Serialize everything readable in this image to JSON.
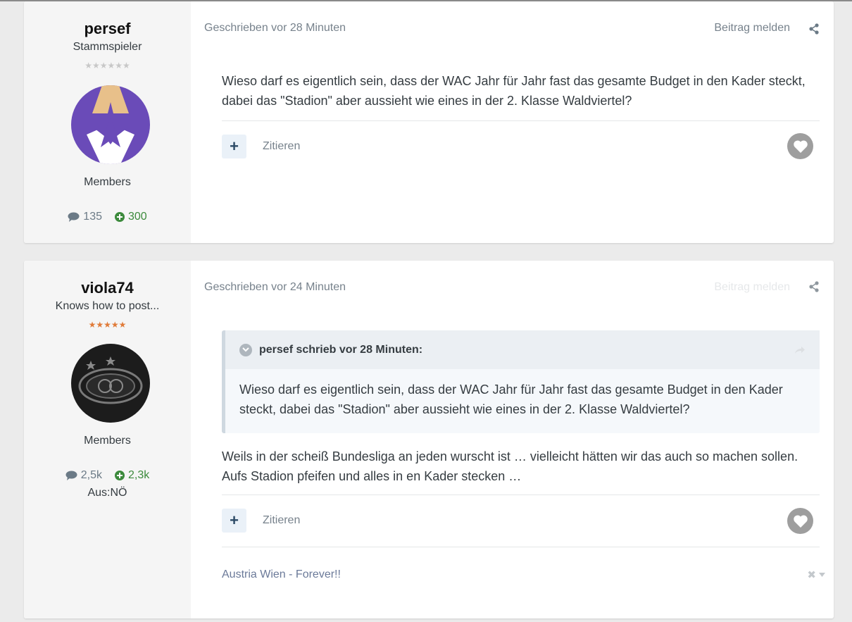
{
  "posts": [
    {
      "author": {
        "username": "persef",
        "rank": "Stammspieler",
        "stars": "★★★★★★",
        "group": "Members",
        "post_count": "135",
        "reputation": "300"
      },
      "meta": "Geschrieben vor 28 Minuten",
      "report_label": "Beitrag melden",
      "body": "Wieso darf es eigentlich sein, dass der WAC Jahr für Jahr fast das gesamte Budget in den Kader steckt, dabei das \"Stadion\" aber aussieht wie eines in der 2. Klasse Waldviertel?",
      "plus_label": "+",
      "quote_label": "Zitieren"
    },
    {
      "author": {
        "username": "viola74",
        "rank": "Knows how to post...",
        "stars": "★★★★★",
        "group": "Members",
        "post_count": "2,5k",
        "reputation": "2,3k",
        "location": "Aus:NÖ"
      },
      "meta": "Geschrieben vor 24 Minuten",
      "report_label": "Beitrag melden",
      "quote": {
        "header": "persef schrieb vor 28 Minuten:",
        "text": "Wieso darf es eigentlich sein, dass der WAC Jahr für Jahr fast das gesamte Budget in den Kader steckt, dabei das \"Stadion\" aber aussieht wie eines in der 2. Klasse Waldviertel?"
      },
      "body": "Weils in der scheiß Bundesliga an jeden wurscht ist … vielleicht hätten wir das auch so machen sollen. Aufs Stadion pfeifen und alles in en Kader stecken …",
      "plus_label": "+",
      "quote_label": "Zitieren",
      "signature": "Austria Wien - Forever!!"
    }
  ],
  "colors": {
    "page_bg": "#ebebeb",
    "author_panel_bg": "#f5f5f5",
    "reputation_green": "#3c8a3c",
    "star_orange": "#e07b39",
    "link_grey": "#77828c"
  }
}
